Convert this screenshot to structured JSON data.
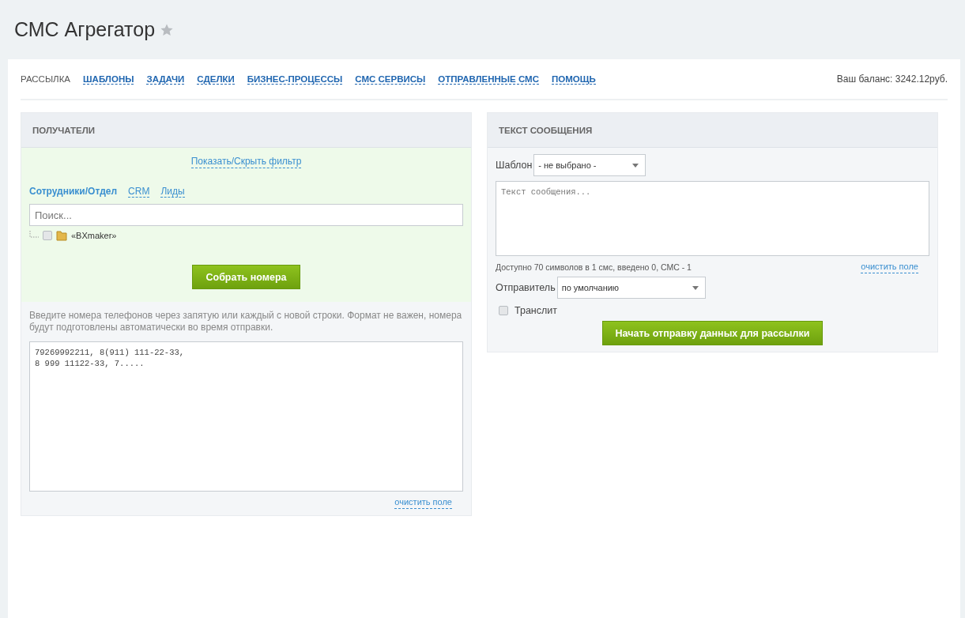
{
  "page": {
    "title": "СМС Агрегатор",
    "starred": false
  },
  "nav": {
    "items": [
      {
        "label": "РАССЫЛКА",
        "selected": true
      },
      {
        "label": "ШАБЛОНЫ",
        "selected": false
      },
      {
        "label": "ЗАДАЧИ",
        "selected": false
      },
      {
        "label": "СДЕЛКИ",
        "selected": false
      },
      {
        "label": "БИЗНЕС-ПРОЦЕССЫ",
        "selected": false
      },
      {
        "label": "СМС СЕРВИСЫ",
        "selected": false
      },
      {
        "label": "ОТПРАВЛЕННЫЕ СМС",
        "selected": false
      },
      {
        "label": "ПОМОЩЬ",
        "selected": false
      }
    ],
    "balance": "Ваш баланс: 3242.12руб."
  },
  "recipients": {
    "title": "ПОЛУЧАТЕЛИ",
    "filter_toggle": "Показать/Скрыть фильтр",
    "tabs": [
      {
        "label": "Сотрудники/Отдел",
        "selected": true
      },
      {
        "label": "CRM",
        "selected": false
      },
      {
        "label": "Лиды",
        "selected": false
      }
    ],
    "search": {
      "placeholder": "Поиск..."
    },
    "tree": [
      {
        "label": "«BXmaker»",
        "checked": false
      }
    ],
    "collect_button": "Собрать номера",
    "hint": "Введите номера телефонов через запятую или каждый с новой строки. Формат не важен, номера будут подготовлены автоматически во время отправки.",
    "phones": "79269992211, 8(911) 111-22-33,\n8 999 11122-33, 7.....",
    "clear_link": "очистить поле"
  },
  "message": {
    "title": "ТЕКСТ СООБЩЕНИЯ",
    "template_label": "Шаблон",
    "template_value": "- не выбрано -",
    "text": {
      "placeholder": "Текст сообщения..."
    },
    "counter": "Доступно 70 символов в 1 смс, введено 0, СМС - 1",
    "clear_link": "очистить поле",
    "sender_label": "Отправитель",
    "sender_value": "по умолчанию",
    "translit": {
      "label": "Транслит",
      "checked": false
    },
    "send_button": "Начать отправку данных для рассылки"
  }
}
